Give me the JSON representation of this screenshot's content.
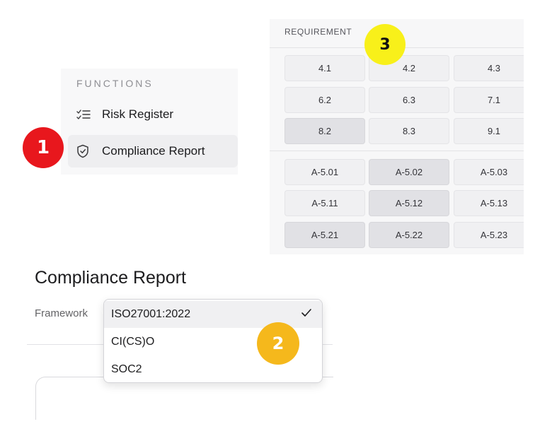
{
  "functions": {
    "heading": "FUNCTIONS",
    "items": [
      {
        "label": "Risk Register",
        "icon": "checklist-icon"
      },
      {
        "label": "Compliance Report",
        "icon": "shield-check-icon",
        "selected": true
      }
    ]
  },
  "requirements": {
    "header": "REQUIREMENT",
    "group1": [
      [
        "4.1",
        "4.2",
        "4.3"
      ],
      [
        "6.2",
        "6.3",
        "7.1"
      ],
      [
        "8.2",
        "8.3",
        "9.1"
      ]
    ],
    "group2": [
      [
        "A-5.01",
        "A-5.02",
        "A-5.03"
      ],
      [
        "A-5.11",
        "A-5.12",
        "A-5.13"
      ],
      [
        "A-5.21",
        "A-5.22",
        "A-5.23"
      ]
    ]
  },
  "report": {
    "title": "Compliance Report",
    "framework_label": "Framework",
    "framework_options": [
      "ISO27001:2022",
      "CI(CS)O",
      "SOC2"
    ],
    "selected_framework": "ISO27001:2022"
  },
  "badges": {
    "one": {
      "label": "1",
      "color": "#e8171d"
    },
    "two": {
      "label": "2",
      "color": "#f5b81c"
    },
    "three": {
      "label": "3",
      "color": "#f8f01a"
    }
  },
  "colors": {
    "panel_bg": "#f8f8f9",
    "cell_bg": "#f0f0f2",
    "cell_selected_bg": "#e1e1e5"
  }
}
